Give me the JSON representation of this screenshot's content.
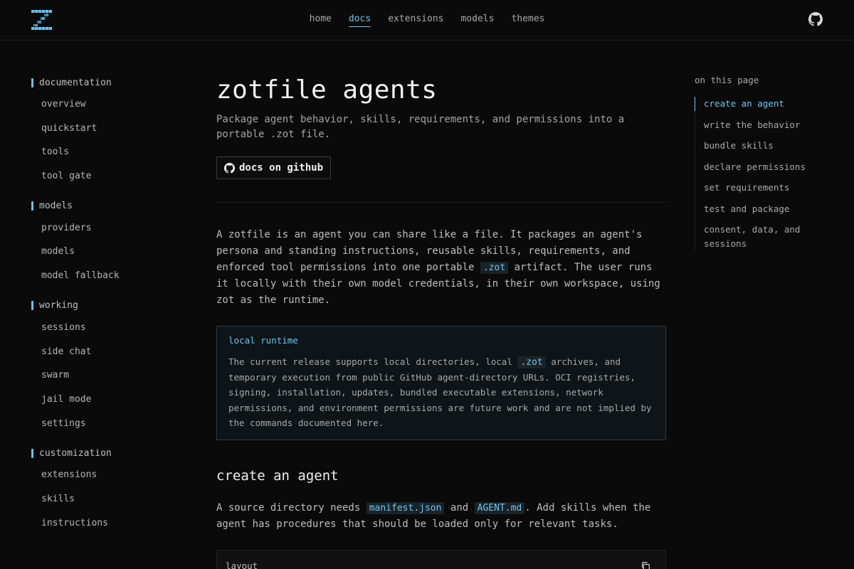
{
  "nav": {
    "items": [
      "home",
      "docs",
      "extensions",
      "models",
      "themes"
    ],
    "active": "docs"
  },
  "sidebar": {
    "sections": [
      {
        "title": "documentation",
        "items": [
          "overview",
          "quickstart",
          "tools",
          "tool gate"
        ]
      },
      {
        "title": "models",
        "items": [
          "providers",
          "models",
          "model fallback"
        ]
      },
      {
        "title": "working",
        "items": [
          "sessions",
          "side chat",
          "swarm",
          "jail mode",
          "settings"
        ]
      },
      {
        "title": "customization",
        "items": [
          "extensions",
          "skills",
          "instructions"
        ]
      }
    ]
  },
  "page": {
    "title": "zotfile agents",
    "subtitle": "Package agent behavior, skills, requirements, and permissions into a portable .zot file.",
    "github_button": "docs on github",
    "intro_before": "A zotfile is an agent you can share like a file. It packages an agent's persona and standing instructions, reusable skills, requirements, and enforced tool permissions into one portable ",
    "intro_code": ".zot",
    "intro_after": " artifact. The user runs it locally with their own model credentials, in their own workspace, using zot as the runtime.",
    "callout": {
      "title": "local runtime",
      "body_before": "The current release supports local directories, local ",
      "body_code": ".zot",
      "body_after": " archives, and temporary execution from public GitHub agent-directory URLs. OCI registries, signing, installation, updates, bundled executable extensions, network permissions, and environment permissions are future work and are not implied by the commands documented here."
    },
    "section_heading": "create an agent",
    "section_p_1": "A source directory needs ",
    "section_code_1": "manifest.json",
    "section_p_2": " and ",
    "section_code_2": "AGENT.md",
    "section_p_3": ". Add skills when the agent has procedures that should be loaded only for relevant tasks.",
    "code_label": "layout"
  },
  "toc": {
    "title": "on this page",
    "items": [
      "create an agent",
      "write the behavior",
      "bundle skills",
      "declare permissions",
      "set requirements",
      "test and package",
      "consent, data, and sessions"
    ],
    "active_index": 0
  },
  "colors": {
    "accent": "#6cc4ee",
    "background": "#0a0a0a"
  }
}
